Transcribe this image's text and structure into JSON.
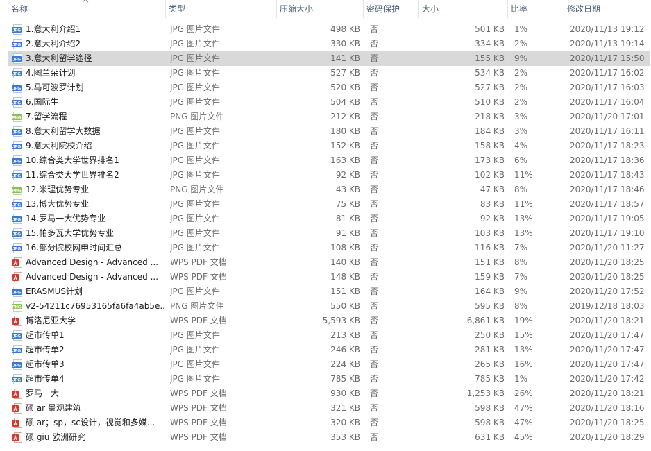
{
  "columns": {
    "name": "名称",
    "type": "类型",
    "compressed": "压缩大小",
    "password": "密码保护",
    "size": "大小",
    "ratio": "比率",
    "modified": "修改日期"
  },
  "colors": {
    "jpg_icon": "#3a7ad1",
    "png_icon": "#8cc152",
    "pdf_icon": "#d9352a",
    "selected_row": "#d9d9d9",
    "header_text": "#4c607a"
  },
  "files": [
    {
      "icon": "jpg-file-icon",
      "name": "1.意大利介绍1",
      "type": "JPG 图片文件",
      "compressed": "498 KB",
      "password": "否",
      "size": "501 KB",
      "ratio": "1%",
      "modified": "2020/11/13 19:12"
    },
    {
      "icon": "jpg-file-icon",
      "name": "2.意大利介绍2",
      "type": "JPG 图片文件",
      "compressed": "330 KB",
      "password": "否",
      "size": "334 KB",
      "ratio": "2%",
      "modified": "2020/11/13 19:14"
    },
    {
      "icon": "jpg-file-icon",
      "name": "3.意大利留学途径",
      "type": "JPG 图片文件",
      "compressed": "141 KB",
      "password": "否",
      "size": "155 KB",
      "ratio": "9%",
      "modified": "2020/11/17 15:50",
      "selected": true
    },
    {
      "icon": "jpg-file-icon",
      "name": "4.图兰朵计划",
      "type": "JPG 图片文件",
      "compressed": "527 KB",
      "password": "否",
      "size": "534 KB",
      "ratio": "2%",
      "modified": "2020/11/17 16:02"
    },
    {
      "icon": "jpg-file-icon",
      "name": "5.马可波罗计划",
      "type": "JPG 图片文件",
      "compressed": "520 KB",
      "password": "否",
      "size": "527 KB",
      "ratio": "2%",
      "modified": "2020/11/17 16:03"
    },
    {
      "icon": "jpg-file-icon",
      "name": "6.国际生",
      "type": "JPG 图片文件",
      "compressed": "504 KB",
      "password": "否",
      "size": "510 KB",
      "ratio": "2%",
      "modified": "2020/11/17 16:04"
    },
    {
      "icon": "png-file-icon",
      "name": "7.留学流程",
      "type": "PNG 图片文件",
      "compressed": "212 KB",
      "password": "否",
      "size": "218 KB",
      "ratio": "3%",
      "modified": "2020/11/20 17:01"
    },
    {
      "icon": "jpg-file-icon",
      "name": "8.意大利留学大数据",
      "type": "JPG 图片文件",
      "compressed": "180 KB",
      "password": "否",
      "size": "184 KB",
      "ratio": "3%",
      "modified": "2020/11/17 16:11"
    },
    {
      "icon": "jpg-file-icon",
      "name": "9.意大利院校介绍",
      "type": "JPG 图片文件",
      "compressed": "152 KB",
      "password": "否",
      "size": "158 KB",
      "ratio": "4%",
      "modified": "2020/11/17 18:23"
    },
    {
      "icon": "jpg-file-icon",
      "name": "10.综合类大学世界排名1",
      "type": "JPG 图片文件",
      "compressed": "163 KB",
      "password": "否",
      "size": "173 KB",
      "ratio": "6%",
      "modified": "2020/11/17 18:36"
    },
    {
      "icon": "jpg-file-icon",
      "name": "11.综合类大学世界排名2",
      "type": "JPG 图片文件",
      "compressed": "92 KB",
      "password": "否",
      "size": "102 KB",
      "ratio": "11%",
      "modified": "2020/11/17 18:43"
    },
    {
      "icon": "png-file-icon",
      "name": "12.米理优势专业",
      "type": "PNG 图片文件",
      "compressed": "43 KB",
      "password": "否",
      "size": "47 KB",
      "ratio": "8%",
      "modified": "2020/11/17 18:46"
    },
    {
      "icon": "jpg-file-icon",
      "name": "13.博大优势专业",
      "type": "JPG 图片文件",
      "compressed": "75 KB",
      "password": "否",
      "size": "83 KB",
      "ratio": "11%",
      "modified": "2020/11/17 18:57"
    },
    {
      "icon": "jpg-file-icon",
      "name": "14.罗马一大优势专业",
      "type": "JPG 图片文件",
      "compressed": "81 KB",
      "password": "否",
      "size": "92 KB",
      "ratio": "13%",
      "modified": "2020/11/17 19:05"
    },
    {
      "icon": "jpg-file-icon",
      "name": "15.帕多瓦大学优势专业",
      "type": "JPG 图片文件",
      "compressed": "91 KB",
      "password": "否",
      "size": "103 KB",
      "ratio": "13%",
      "modified": "2020/11/17 19:10"
    },
    {
      "icon": "jpg-file-icon",
      "name": "16.部分院校网申时间汇总",
      "type": "JPG 图片文件",
      "compressed": "108 KB",
      "password": "否",
      "size": "116 KB",
      "ratio": "7%",
      "modified": "2020/11/20 11:27"
    },
    {
      "icon": "pdf-file-icon",
      "name": "Advanced Design  - Advanced ...",
      "type": "WPS PDF 文档",
      "compressed": "140 KB",
      "password": "否",
      "size": "151 KB",
      "ratio": "8%",
      "modified": "2020/11/20 18:25"
    },
    {
      "icon": "pdf-file-icon",
      "name": "Advanced Design  - Advanced ...",
      "type": "WPS PDF 文档",
      "compressed": "148 KB",
      "password": "否",
      "size": "159 KB",
      "ratio": "7%",
      "modified": "2020/11/20 18:25"
    },
    {
      "icon": "jpg-file-icon",
      "name": "ERASMUS计划",
      "type": "JPG 图片文件",
      "compressed": "151 KB",
      "password": "否",
      "size": "164 KB",
      "ratio": "9%",
      "modified": "2020/11/20 17:52"
    },
    {
      "icon": "png-file-icon",
      "name": "v2-54211c76953165fa6fa4ab5e...",
      "type": "PNG 图片文件",
      "compressed": "550 KB",
      "password": "否",
      "size": "595 KB",
      "ratio": "8%",
      "modified": "2019/12/18 18:03"
    },
    {
      "icon": "pdf-file-icon",
      "name": "博洛尼亚大学",
      "type": "WPS PDF 文档",
      "compressed": "5,593 KB",
      "password": "否",
      "size": "6,861 KB",
      "ratio": "19%",
      "modified": "2020/11/20 18:21"
    },
    {
      "icon": "jpg-file-icon",
      "name": "超市传单1",
      "type": "JPG 图片文件",
      "compressed": "213 KB",
      "password": "否",
      "size": "250 KB",
      "ratio": "15%",
      "modified": "2020/11/20 17:47"
    },
    {
      "icon": "jpg-file-icon",
      "name": "超市传单2",
      "type": "JPG 图片文件",
      "compressed": "246 KB",
      "password": "否",
      "size": "281 KB",
      "ratio": "13%",
      "modified": "2020/11/20 17:47"
    },
    {
      "icon": "jpg-file-icon",
      "name": "超市传单3",
      "type": "JPG 图片文件",
      "compressed": "224 KB",
      "password": "否",
      "size": "265 KB",
      "ratio": "16%",
      "modified": "2020/11/20 17:47"
    },
    {
      "icon": "jpg-file-icon",
      "name": "超市传单4",
      "type": "JPG 图片文件",
      "compressed": "785 KB",
      "password": "否",
      "size": "785 KB",
      "ratio": "1%",
      "modified": "2020/11/20 17:42"
    },
    {
      "icon": "pdf-file-icon",
      "name": "罗马一大",
      "type": "WPS PDF 文档",
      "compressed": "930 KB",
      "password": "否",
      "size": "1,253 KB",
      "ratio": "26%",
      "modified": "2020/11/20 18:21"
    },
    {
      "icon": "pdf-file-icon",
      "name": "硕 ar 景观建筑",
      "type": "WPS PDF 文档",
      "compressed": "321 KB",
      "password": "否",
      "size": "598 KB",
      "ratio": "47%",
      "modified": "2020/11/20 18:16"
    },
    {
      "icon": "pdf-file-icon",
      "name": "硕 ar；sp，sc设计，视觉和多媒...",
      "type": "WPS PDF 文档",
      "compressed": "320 KB",
      "password": "否",
      "size": "598 KB",
      "ratio": "47%",
      "modified": "2020/11/20 18:25"
    },
    {
      "icon": "pdf-file-icon",
      "name": "硕 giu 欧洲研究",
      "type": "WPS PDF 文档",
      "compressed": "353 KB",
      "password": "否",
      "size": "631 KB",
      "ratio": "45%",
      "modified": "2020/11/20 18:29"
    }
  ]
}
